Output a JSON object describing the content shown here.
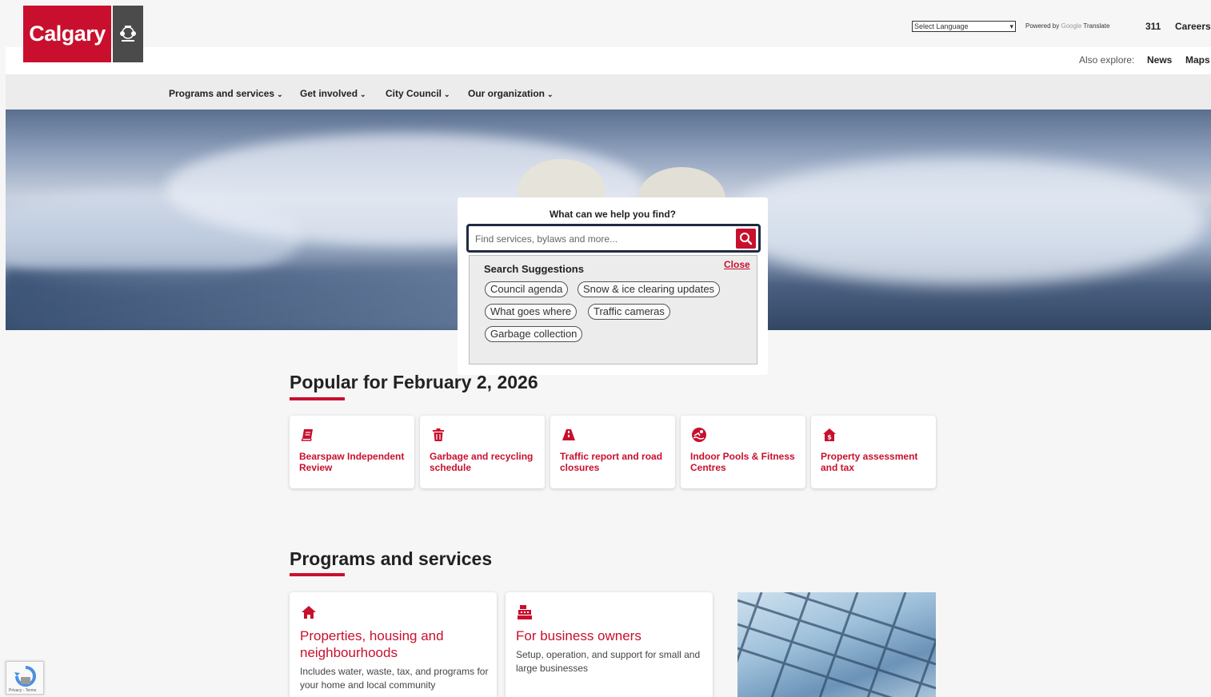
{
  "header": {
    "logo_text": "Calgary",
    "language_select": "Select Language",
    "powered_by": "Powered by",
    "google": "Google",
    "translate": "Translate",
    "link_311": "311",
    "link_careers": "Careers",
    "also_explore": "Also explore:",
    "link_news": "News",
    "link_maps": "Maps"
  },
  "nav": {
    "items": [
      {
        "label": "Programs and services"
      },
      {
        "label": "Get involved"
      },
      {
        "label": "City Council"
      },
      {
        "label": "Our organization"
      }
    ]
  },
  "search": {
    "heading": "What can we help you find?",
    "placeholder": "Find services, bylaws and more...",
    "suggestions_title": "Search Suggestions",
    "close_label": "Close",
    "chips": [
      "Council agenda",
      "Snow & ice clearing updates",
      "What goes where",
      "Traffic cameras",
      "Garbage collection"
    ]
  },
  "popular": {
    "title": "Popular for February 2, 2026",
    "cards": [
      {
        "label": "Bearspaw Independent Review",
        "icon": "book-icon"
      },
      {
        "label": "Garbage and recycling schedule",
        "icon": "trash-icon"
      },
      {
        "label": "Traffic report and road closures",
        "icon": "road-icon"
      },
      {
        "label": "Indoor Pools & Fitness Centres",
        "icon": "swimmer-icon"
      },
      {
        "label": "Property assessment and tax",
        "icon": "house-dollar-icon"
      }
    ]
  },
  "programs": {
    "title": "Programs and services",
    "cards": [
      {
        "title": "Properties, housing and neighbourhoods",
        "desc": "Includes water, waste, tax, and programs for your home and local community",
        "icon": "home-icon"
      },
      {
        "title": "For business owners",
        "desc": "Setup, operation, and support for small and large businesses",
        "icon": "cash-register-icon"
      }
    ]
  },
  "recaptcha": {
    "terms": "Privacy - Terms"
  },
  "colors": {
    "brand_red": "#c8102e",
    "crest_gray": "#4b4b4b"
  }
}
